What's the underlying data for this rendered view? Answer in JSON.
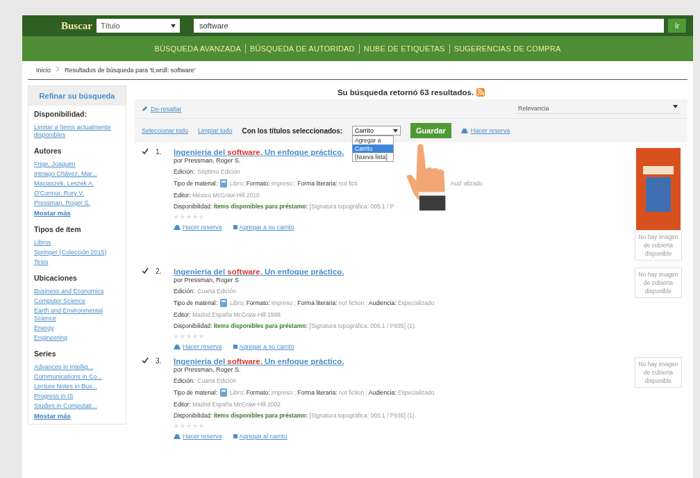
{
  "search_bar": {
    "label": "Buscar",
    "index": "Título",
    "query": "software",
    "go": "Ir"
  },
  "nav": [
    "BÚSQUEDA AVANZADA",
    "BÚSQUEDA DE AUTORIDAD",
    "NUBE DE ETIQUETAS",
    "SUGERENCIAS DE COMPRA"
  ],
  "breadcrumb": [
    "Inicio",
    "Resultados de búsqueda para 'ti,wrdl: software'"
  ],
  "sidebar": {
    "title": "Refinar su búsqueda",
    "groups": [
      {
        "heading": "Disponibilidad:",
        "links": [
          "Limitar a ítems actualmente disponibles"
        ]
      },
      {
        "heading": "Autores",
        "links": [
          "Frige, Joaquim",
          "Intriago Chávez, Mar...",
          "Maciaszek, Leszek A.",
          "O'Connor, Rory V.",
          "Pressman, Roger S."
        ],
        "more": "Mostar más"
      },
      {
        "heading": "Tipos de ítem",
        "links": [
          "Libros",
          "Springer (Colección 2015)",
          "Tesis"
        ]
      },
      {
        "heading": "Ubicaciones",
        "links": [
          "Business and Economics",
          "Computer Science",
          "Earth and Environmental Science",
          "Energy",
          "Engineering"
        ]
      },
      {
        "heading": "Series",
        "links": [
          "Advances in Intellig...",
          "Communications in Co...",
          "Lecture Notes in Bus...",
          "Progress in IS",
          "Studies in Computati..."
        ],
        "more": "Mostar más"
      }
    ]
  },
  "summary": "Su búsqueda retornó 63 resultados.",
  "unhighlight": "De-resaltar",
  "sort": "Relevancia",
  "toolbar": {
    "select_all": "Seleccionar todo",
    "clear_all": "Limpiar todo",
    "with_selected": "Con los títulos seleccionados:",
    "list_value": "Carrito",
    "options": [
      {
        "label": "Agregar a",
        "selected": false
      },
      {
        "label": "Carrito",
        "selected": true
      },
      {
        "label": "[Nueva lista]",
        "selected": false
      }
    ],
    "save": "Guardar",
    "hold": "Hacer reserva"
  },
  "results": [
    {
      "number": "1.",
      "checked": true,
      "title": "Ingeniería del **software**. Un enfoque práctico.",
      "author": "por Pressman, Roger S.",
      "edition_label": "Edición:",
      "edition": "Séptima Edición",
      "material": [
        "**Tipo de material:**",
        "Libro; **Formato:** impreso ; **Forma literaria:** not ficti",
        "Aud",
        "alizado."
      ],
      "publisher": "**Editor:** México McGraw-Hill 2010",
      "availability": [
        "**Disponibilidad:** **Ítems disponibles para préstamo:** [Signatura topográfica: 005.1 / P"
      ],
      "stars": 0,
      "actions": [
        "Hacer reserva",
        "Agregar a su carrito"
      ],
      "cover": {
        "kind": "image",
        "text": "No hay imagen de cubierta disponible"
      }
    },
    {
      "number": "2.",
      "checked": true,
      "title": "Ingeniería del **software**. Un enfoque práctico.",
      "author": "por Pressman, Roger S",
      "edition_label": "Edición:",
      "edition": "Cuarta Edición",
      "material": [
        "**Tipo de material:**",
        "Libro; **Formato:** impreso ; **Forma literaria:** not fiction ; **Audiencia:** Especializado"
      ],
      "publisher": "**Editor:** Madrid España McGraw-Hill 1998",
      "availability": [
        "**Disponibilidad:** **Ítems disponibles para préstamo:** [Signatura topográfica: 005.1 / P935] (1)."
      ],
      "stars": 0,
      "actions": [
        "Hacer reserva",
        "Agregar a su carrito"
      ],
      "cover": {
        "kind": "none",
        "text": "No hay imagen de cubierta disponible"
      }
    },
    {
      "number": "3.",
      "checked": true,
      "title": "Ingeniería del **software**. Un enfoque práctico.",
      "author": "por Pressman, Roger S.",
      "edition_label": "Edición:",
      "edition": "Cuarta Edición",
      "material": [
        "**Tipo de material:**",
        "Libro; **Formato:** impreso ; **Forma literaria:** not fiction ; **Audiencia:** Especializado"
      ],
      "publisher": "**Editor:** Madrid España McGraw-Hill 2002",
      "availability": [
        "**Disponibilidad:** **Ítems disponibles para préstamo:** [Signatura topográfica: 005.1 / P935] (1)."
      ],
      "stars": 0,
      "actions": [
        "Hacer reserva",
        "Agregar al carrito"
      ],
      "cover": {
        "kind": "none",
        "text": "No hay imagen de cubierta disponible"
      }
    }
  ],
  "annotation": {
    "kind": "pointing-hand"
  }
}
